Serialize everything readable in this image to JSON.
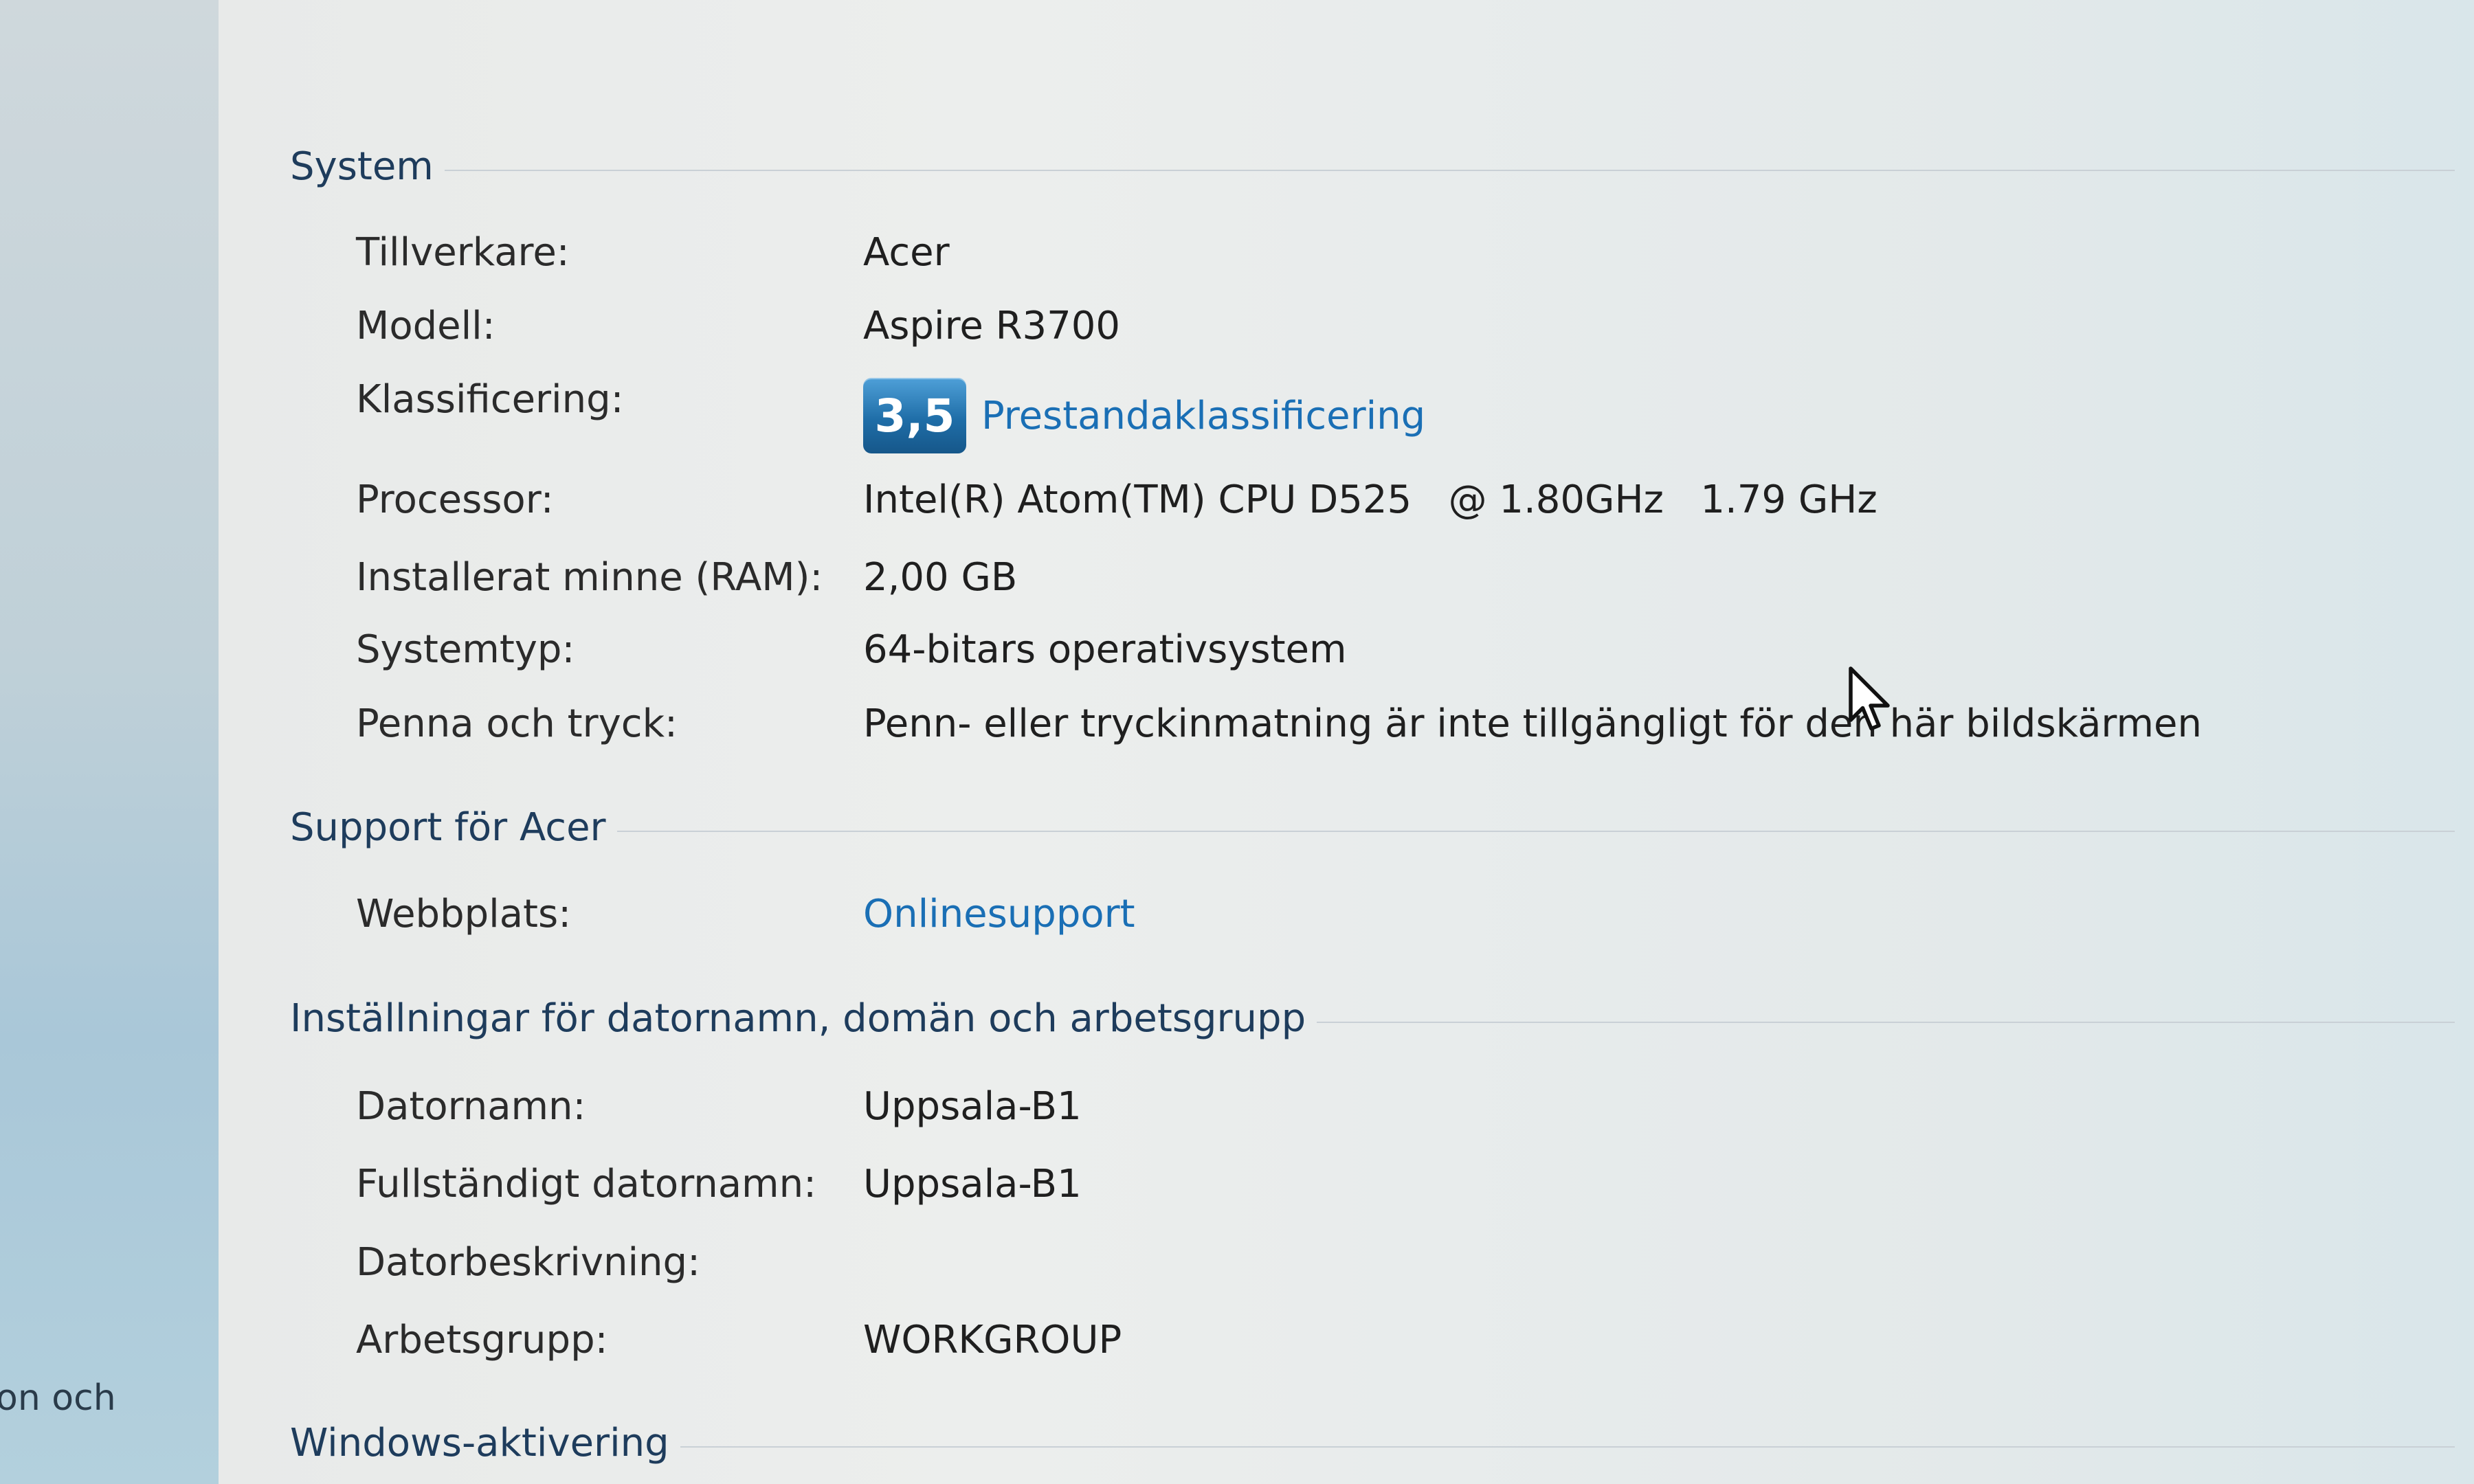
{
  "left_pane": {
    "snippet": "on och"
  },
  "system": {
    "title": "System",
    "rows": [
      {
        "label": "Tillverkare:",
        "value": "Acer"
      },
      {
        "label": "Modell:",
        "value": "Aspire R3700"
      },
      {
        "label": "Klassificering:",
        "rating": "3,5",
        "link": "Prestandaklassificering"
      },
      {
        "label": "Processor:",
        "value": "Intel(R) Atom(TM) CPU D525   @ 1.80GHz   1.79 GHz"
      },
      {
        "label": "Installerat minne (RAM):",
        "value": "2,00 GB"
      },
      {
        "label": "Systemtyp:",
        "value": "64-bitars operativsystem"
      },
      {
        "label": "Penna och tryck:",
        "value": "Penn- eller tryckinmatning är inte tillgängligt för den här bildskärmen"
      }
    ]
  },
  "support": {
    "title": "Support för Acer",
    "rows": [
      {
        "label": "Webbplats:",
        "link": "Onlinesupport"
      }
    ]
  },
  "computer_name": {
    "title": "Inställningar för datornamn, domän och arbetsgrupp",
    "rows": [
      {
        "label": "Datornamn:",
        "value": "Uppsala-B1"
      },
      {
        "label": "Fullständigt datornamn:",
        "value": "Uppsala-B1"
      },
      {
        "label": "Datorbeskrivning:",
        "value": ""
      },
      {
        "label": "Arbetsgrupp:",
        "value": "WORKGROUP"
      }
    ]
  },
  "activation": {
    "title": "Windows-aktivering"
  },
  "colors": {
    "link": "#1a6fb5",
    "section_title": "#1e3c5c",
    "rating_badge": "#1f6ea8"
  },
  "icons": {
    "cursor": "arrow-cursor-icon"
  }
}
